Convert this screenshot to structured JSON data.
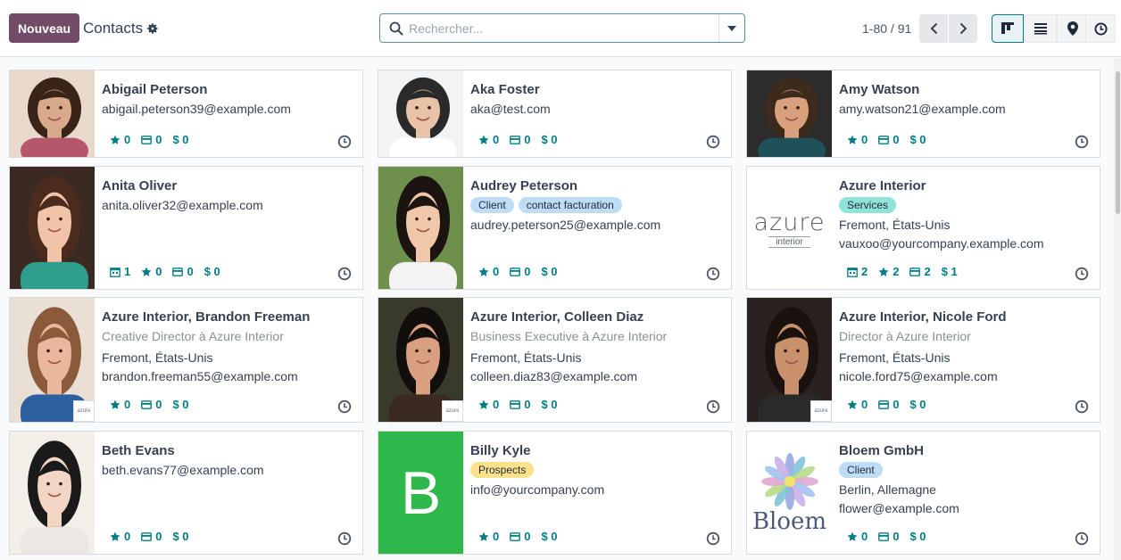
{
  "toolbar": {
    "new_label": "Nouveau",
    "title": "Contacts",
    "gear_icon": "gear-icon",
    "search_placeholder": "Rechercher...",
    "pager_value": "1-80 / 91",
    "views": [
      "kanban-icon",
      "list-icon",
      "map-marker-icon",
      "activity-clock-icon"
    ],
    "active_view": "kanban"
  },
  "colors": {
    "primary": "#714b67",
    "accent": "#017e84",
    "tag_blue": "#bfdcf7",
    "tag_teal": "#8fe3d8",
    "tag_yellow": "#fde28b"
  },
  "cards": [
    {
      "name": "Abigail Peterson",
      "function": "",
      "tags": [],
      "location": "",
      "email": "abigail.peterson39@example.com",
      "meetings": "",
      "opportunities": "0",
      "invoices": "0",
      "sales": "$ 0"
    },
    {
      "name": "Aka Foster",
      "function": "",
      "tags": [],
      "location": "",
      "email": "aka@test.com",
      "meetings": "",
      "opportunities": "0",
      "invoices": "0",
      "sales": "$ 0"
    },
    {
      "name": "Amy Watson",
      "function": "",
      "tags": [],
      "location": "",
      "email": "amy.watson21@example.com",
      "meetings": "",
      "opportunities": "0",
      "invoices": "0",
      "sales": "$ 0"
    },
    {
      "name": "Anita Oliver",
      "function": "",
      "tags": [],
      "location": "",
      "email": "anita.oliver32@example.com",
      "meetings": "1",
      "opportunities": "0",
      "invoices": "0",
      "sales": "$ 0"
    },
    {
      "name": "Audrey Peterson",
      "function": "",
      "tags": [
        "Client",
        "contact facturation"
      ],
      "location": "",
      "email": "audrey.peterson25@example.com",
      "meetings": "",
      "opportunities": "0",
      "invoices": "0",
      "sales": "$ 0"
    },
    {
      "name": "Azure Interior",
      "function": "",
      "tags": [
        "Services"
      ],
      "location": "Fremont, États-Unis",
      "email": "vauxoo@yourcompany.example.com",
      "meetings": "2",
      "opportunities": "2",
      "invoices": "2",
      "sales": "$ 1",
      "logo_text": "azure",
      "logo_sub": "interior"
    },
    {
      "name": "Azure Interior, Brandon Freeman",
      "function": "Creative Director à Azure Interior",
      "tags": [],
      "location": "Fremont, États-Unis",
      "email": "brandon.freeman55@example.com",
      "meetings": "",
      "opportunities": "0",
      "invoices": "0",
      "sales": "$ 0"
    },
    {
      "name": "Azure Interior, Colleen Diaz",
      "function": "Business Executive à Azure Interior",
      "tags": [],
      "location": "Fremont, États-Unis",
      "email": "colleen.diaz83@example.com",
      "meetings": "",
      "opportunities": "0",
      "invoices": "0",
      "sales": "$ 0"
    },
    {
      "name": "Azure Interior, Nicole Ford",
      "function": "Director à Azure Interior",
      "tags": [],
      "location": "Fremont, États-Unis",
      "email": "nicole.ford75@example.com",
      "meetings": "",
      "opportunities": "0",
      "invoices": "0",
      "sales": "$ 0"
    },
    {
      "name": "Beth Evans",
      "function": "",
      "tags": [],
      "location": "",
      "email": "beth.evans77@example.com",
      "meetings": "",
      "opportunities": "0",
      "invoices": "0",
      "sales": "$ 0"
    },
    {
      "name": "Billy Kyle",
      "function": "",
      "tags": [
        "Prospects"
      ],
      "location": "",
      "email": "info@yourcompany.com",
      "meetings": "",
      "opportunities": "0",
      "invoices": "0",
      "sales": "$ 0",
      "initial": "B"
    },
    {
      "name": "Bloem GmbH",
      "function": "",
      "tags": [
        "Client"
      ],
      "location": "Berlin, Allemagne",
      "email": "flower@example.com",
      "meetings": "",
      "opportunities": "0",
      "invoices": "0",
      "sales": "$ 0",
      "logo_text": "Bloem"
    }
  ]
}
